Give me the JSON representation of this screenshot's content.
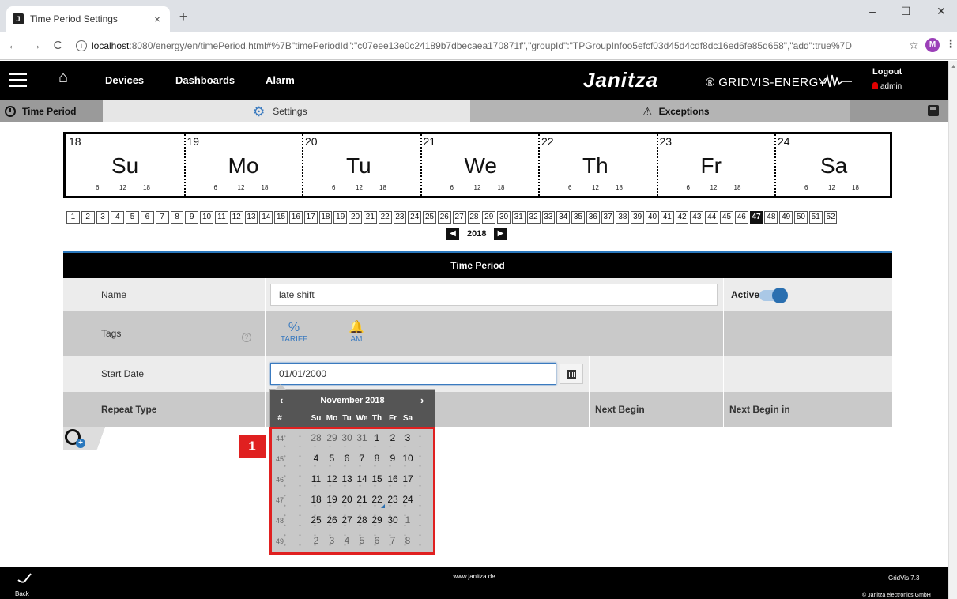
{
  "browser": {
    "tab_title": "Time Period Settings",
    "tab_close": "×",
    "new_tab": "+",
    "win_min": "–",
    "win_max": "☐",
    "win_close": "✕",
    "nav_back": "←",
    "nav_forward": "→",
    "nav_reload": "C",
    "url_host": "localhost",
    "url_rest": ":8080/energy/en/timePeriod.html#%7B\"timePeriodId\":\"c07eee13e0c24189b7dbecaea170871f\",\"groupId\":\"TPGroupInfoo5efcf03d45d4cdf8dc16ed6fe85d658\",\"add\":true%7D",
    "profile_initial": "M"
  },
  "header": {
    "nav": [
      "Devices",
      "Dashboards",
      "Alarm"
    ],
    "brand": "Janitza",
    "brand_sub": "® GRIDVIS-ENERGY",
    "logout": "Logout",
    "user": "admin"
  },
  "subheader": {
    "time_period": "Time Period",
    "settings": "Settings",
    "exceptions": "Exceptions"
  },
  "week_strip": {
    "days": [
      {
        "num": "18",
        "name": "Su"
      },
      {
        "num": "19",
        "name": "Mo"
      },
      {
        "num": "20",
        "name": "Tu"
      },
      {
        "num": "21",
        "name": "We"
      },
      {
        "num": "22",
        "name": "Th"
      },
      {
        "num": "23",
        "name": "Fr"
      },
      {
        "num": "24",
        "name": "Sa"
      }
    ],
    "ticks": [
      "6",
      "12",
      "18"
    ]
  },
  "week_picker": {
    "weeks": [
      "1",
      "2",
      "3",
      "4",
      "5",
      "6",
      "7",
      "8",
      "9",
      "10",
      "11",
      "12",
      "13",
      "14",
      "15",
      "16",
      "17",
      "18",
      "19",
      "20",
      "21",
      "22",
      "23",
      "24",
      "25",
      "26",
      "27",
      "28",
      "29",
      "30",
      "31",
      "32",
      "33",
      "34",
      "35",
      "36",
      "37",
      "38",
      "39",
      "40",
      "41",
      "42",
      "43",
      "44",
      "45",
      "46",
      "47",
      "48",
      "49",
      "50",
      "51",
      "52"
    ],
    "selected": "47",
    "year": "2018",
    "prev": "◀",
    "next": "▶"
  },
  "form": {
    "title": "Time Period",
    "name_label": "Name",
    "name_value": "late shift",
    "active_label": "Active",
    "active": true,
    "tags_label": "Tags",
    "help": "?",
    "tags": [
      {
        "icon": "%",
        "label": "TARIFF"
      },
      {
        "icon": "🔔",
        "label": "AM"
      }
    ],
    "start_label": "Start Date",
    "start_value": "01/01/2000",
    "repeat_label": "Repeat Type",
    "next_begin": "Next Begin",
    "next_begin_in": "Next Begin in"
  },
  "datepicker": {
    "month": "November 2018",
    "prev": "‹",
    "next": "›",
    "wk_header": "#",
    "dow": [
      "Su",
      "Mo",
      "Tu",
      "We",
      "Th",
      "Fr",
      "Sa"
    ],
    "rows": [
      {
        "wk": "44",
        "days": [
          "28",
          "29",
          "30",
          "31",
          "1",
          "2",
          "3"
        ]
      },
      {
        "wk": "45",
        "days": [
          "4",
          "5",
          "6",
          "7",
          "8",
          "9",
          "10"
        ]
      },
      {
        "wk": "46",
        "days": [
          "11",
          "12",
          "13",
          "14",
          "15",
          "16",
          "17"
        ]
      },
      {
        "wk": "47",
        "days": [
          "18",
          "19",
          "20",
          "21",
          "22",
          "23",
          "24"
        ]
      },
      {
        "wk": "48",
        "days": [
          "25",
          "26",
          "27",
          "28",
          "29",
          "30",
          "1"
        ]
      },
      {
        "wk": "49",
        "days": [
          "2",
          "3",
          "4",
          "5",
          "6",
          "7",
          "8"
        ]
      }
    ],
    "today": "22"
  },
  "annotation": {
    "badge": "1"
  },
  "footer": {
    "back": "Back",
    "url": "www.janitza.de",
    "version": "GridVis 7.3",
    "copyright": "© Janitza electronics GmbH"
  },
  "colors": {
    "accent": "#2a78bd",
    "highlight": "#e02020"
  }
}
